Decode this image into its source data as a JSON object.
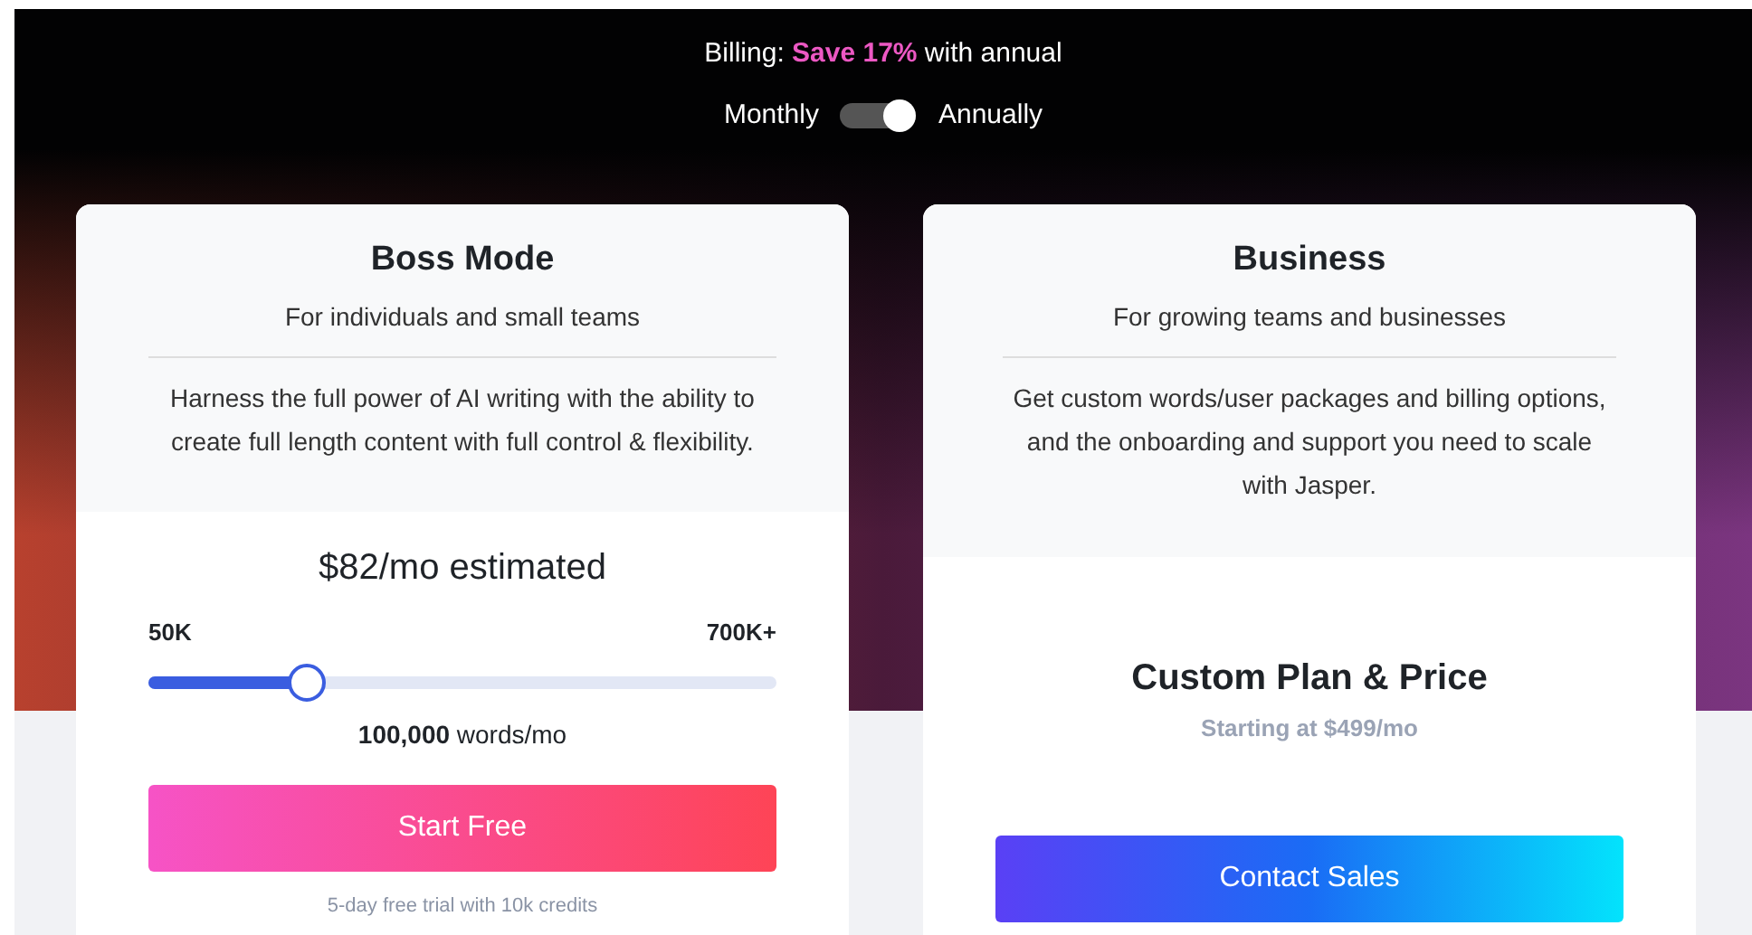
{
  "billing": {
    "label": "Billing:",
    "highlight": "Save 17%",
    "rest": "with annual"
  },
  "toggle": {
    "left": "Monthly",
    "right": "Annually",
    "on": true
  },
  "plans": [
    {
      "kind": "slider",
      "name": "Boss Mode",
      "subtitle": "For individuals and small teams",
      "description": "Harness the full power of AI writing with the ability to create full length content with full control & flexibility.",
      "price": "$82/mo estimated",
      "min": "50K",
      "max": "700K+",
      "level": 0.25,
      "words_count": "100,000",
      "words_unit": "words/mo",
      "button": "Start Free",
      "note": "5-day free trial with 10k credits"
    },
    {
      "kind": "custom",
      "name": "Business",
      "subtitle": "For growing teams and businesses",
      "description": "Get custom words/user packages and billing options, and the onboarding and support you need to scale with Jasper.",
      "price": "Custom Plan & Price",
      "starting": "Starting at $499/mo",
      "button": "Contact Sales"
    }
  ]
}
